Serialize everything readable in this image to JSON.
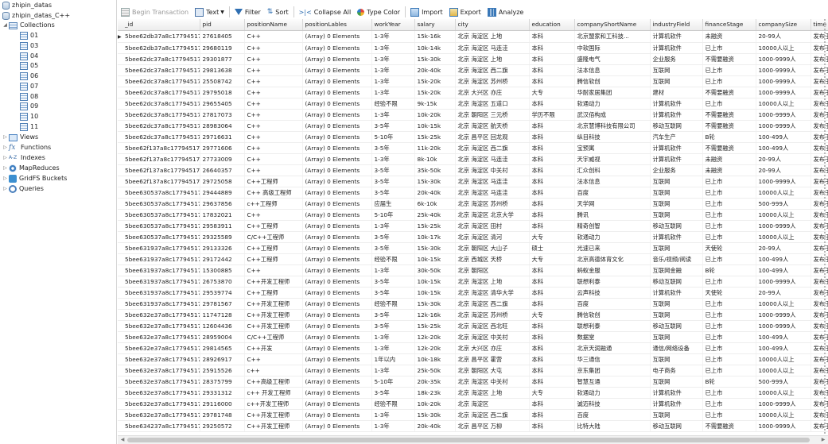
{
  "sidebar": {
    "db1": "zhipin_datas",
    "db2": "zhipin_datas_C++",
    "collections_label": "Collections",
    "collections": [
      "01",
      "03",
      "04",
      "05",
      "06",
      "07",
      "08",
      "09",
      "10",
      "11"
    ],
    "views_label": "Views",
    "functions_label": "Functions",
    "indexes_label": "Indexes",
    "mapreduces_label": "MapReduces",
    "gridfs_label": "GridFS Buckets",
    "queries_label": "Queries"
  },
  "toolbar": {
    "begin_transaction": "Begin Transaction",
    "text": "Text",
    "filter": "Filter",
    "sort": "Sort",
    "collapse_all": "Collapse All",
    "type_color": "Type Color",
    "import": "Import",
    "export": "Export",
    "analyze": "Analyze"
  },
  "grid": {
    "columns": [
      "_id",
      "pid",
      "positionName",
      "positionLables",
      "workYear",
      "salary",
      "city",
      "education",
      "companyShortName",
      "industryField",
      "financeStage",
      "companySize",
      "time"
    ],
    "rows": [
      [
        "5bee62db37a8c17794517",
        "27618405",
        "C++",
        "(Array) 0 Elements",
        "1-3年",
        "15k-16k",
        "北京 海淀区 上地",
        "本科",
        "北京盟家和工科技...",
        "计算机软件",
        "未融资",
        "20-99人",
        "发布于"
      ],
      [
        "5bee62db37a8c17794517",
        "29680119",
        "C++",
        "(Array) 0 Elements",
        "1-3年",
        "10k-14k",
        "北京 海淀区 马连洼",
        "本科",
        "中软国际",
        "计算机软件",
        "已上市",
        "10000人以上",
        "发布于"
      ],
      [
        "5bee62dc37a8c17794517",
        "29301877",
        "C++",
        "(Array) 0 Elements",
        "1-3年",
        "15k-30k",
        "北京 海淀区 上地",
        "本科",
        "盛隆电气",
        "企业服务",
        "不需要融资",
        "1000-9999人",
        "发布于"
      ],
      [
        "5bee62dc37a8c17794517",
        "29813638",
        "C++",
        "(Array) 0 Elements",
        "1-3年",
        "20k-40k",
        "北京 海淀区 西二旗",
        "本科",
        "法本信息",
        "互联网",
        "已上市",
        "1000-9999人",
        "发布于"
      ],
      [
        "5bee62dc37a8c17794517",
        "25508742",
        "C++",
        "(Array) 0 Elements",
        "1-3年",
        "15k-20k",
        "北京 海淀区 苏州桥",
        "本科",
        "腾信软创",
        "互联网",
        "已上市",
        "1000-9999人",
        "发布于"
      ],
      [
        "5bee62dc37a8c17794517",
        "29795018",
        "C++",
        "(Array) 0 Elements",
        "1-3年",
        "15k-20k",
        "北京 大兴区 亦庄",
        "大专",
        "华耐家居集团",
        "建材",
        "不需要融资",
        "1000-9999人",
        "发布于"
      ],
      [
        "5bee62dc37a8c17794517",
        "29655405",
        "C++",
        "(Array) 0 Elements",
        "经验不限",
        "9k-15k",
        "北京 海淀区 五道口",
        "本科",
        "软通动力",
        "计算机软件",
        "已上市",
        "10000人以上",
        "发布于"
      ],
      [
        "5bee62dc37a8c17794517",
        "27817073",
        "C++",
        "(Array) 0 Elements",
        "1-3年",
        "10k-20k",
        "北京 朝阳区 三元桥",
        "学历不限",
        "武汉佰构成",
        "计算机软件",
        "不需要融资",
        "1000-9999人",
        "发布于"
      ],
      [
        "5bee62dc37a8c17794517",
        "28983064",
        "C++",
        "(Array) 0 Elements",
        "3-5年",
        "10k-15k",
        "北京 海淀区 航天桥",
        "本科",
        "北京慧博科技有限公司",
        "移动互联网",
        "不需要融资",
        "1000-9999人",
        "发布于"
      ],
      [
        "5bee62dc37a8c17794517",
        "29716631",
        "C++",
        "(Array) 0 Elements",
        "5-10年",
        "15k-25k",
        "北京 昌平区 回龙观",
        "本科",
        "纵目科技",
        "汽车生产",
        "B轮",
        "100-499人",
        "发布于"
      ],
      [
        "5bee62f137a8c17794517",
        "29771606",
        "C++",
        "(Array) 0 Elements",
        "3-5年",
        "11k-20k",
        "北京 海淀区 西二旗",
        "本科",
        "宝预寓",
        "计算机软件",
        "不需要融资",
        "100-499人",
        "发布于"
      ],
      [
        "5bee62f137a8c17794517",
        "27733009",
        "C++",
        "(Array) 0 Elements",
        "1-3年",
        "8k-10k",
        "北京 海淀区 马连洼",
        "本科",
        "天宇威视",
        "计算机软件",
        "未融资",
        "20-99人",
        "发布于"
      ],
      [
        "5bee62f137a8c17794517",
        "26640357",
        "C++",
        "(Array) 0 Elements",
        "3-5年",
        "35k-50k",
        "北京 海淀区 中关村",
        "本科",
        "汇众创科",
        "企业服务",
        "未融资",
        "20-99人",
        "发布于"
      ],
      [
        "5bee62f137a8c17794517",
        "29725058",
        "C++工程师",
        "(Array) 0 Elements",
        "3-5年",
        "15k-30k",
        "北京 海淀区 马连洼",
        "本科",
        "法本信息",
        "互联网",
        "已上市",
        "1000-9999人",
        "发布于"
      ],
      [
        "5bee630537a8c17794517",
        "29444889",
        "C++ 高级工程师",
        "(Array) 0 Elements",
        "3-5年",
        "20k-40k",
        "北京 海淀区 马连洼",
        "本科",
        "百度",
        "互联网",
        "已上市",
        "10000人以上",
        "发布于"
      ],
      [
        "5bee630537a8c17794517",
        "29637856",
        "c++工程师",
        "(Array) 0 Elements",
        "应届生",
        "6k-10k",
        "北京 海淀区 苏州桥",
        "本科",
        "天学网",
        "互联网",
        "已上市",
        "500-999人",
        "发布于"
      ],
      [
        "5bee630537a8c17794517",
        "17832021",
        "C++",
        "(Array) 0 Elements",
        "5-10年",
        "25k-40k",
        "北京 海淀区 北京大学",
        "本科",
        "腾讯",
        "互联网",
        "已上市",
        "10000人以上",
        "发布于"
      ],
      [
        "5bee630537a8c17794517",
        "29583911",
        "C++工程师",
        "(Array) 0 Elements",
        "1-3年",
        "15k-25k",
        "北京 海淀区 田村",
        "本科",
        "精奇创智",
        "移动互联网",
        "已上市",
        "1000-9999人",
        "发布于"
      ],
      [
        "5bee630537a8c17794517",
        "29325589",
        "C/C++工程师",
        "(Array) 0 Elements",
        "3-5年",
        "10k-17k",
        "北京 海淀区 清河",
        "大专",
        "软通动力",
        "计算机软件",
        "已上市",
        "10000人以上",
        "发布于"
      ],
      [
        "5bee631937a8c17794517",
        "29133326",
        "C++工程师",
        "(Array) 0 Elements",
        "3-5年",
        "15k-30k",
        "北京 朝阳区 大山子",
        "硕士",
        "光速已来",
        "互联网",
        "天使轮",
        "20-99人",
        "发布于"
      ],
      [
        "5bee631937a8c17794517",
        "29172442",
        "C++工程师",
        "(Array) 0 Elements",
        "经验不限",
        "10k-15k",
        "北京 西城区 天桥",
        "大专",
        "北京高德体育文化",
        "音乐/视频/阅读",
        "已上市",
        "100-499人",
        "发布于"
      ],
      [
        "5bee631937a8c17794517",
        "15300885",
        "C++",
        "(Array) 0 Elements",
        "1-3年",
        "30k-50k",
        "北京 朝阳区",
        "本科",
        "蚂蚁金服",
        "互联网金融",
        "B轮",
        "100-499人",
        "发布于"
      ],
      [
        "5bee631937a8c17794517",
        "26753870",
        "C++开发工程师",
        "(Array) 0 Elements",
        "3-5年",
        "10k-15k",
        "北京 海淀区 上地",
        "本科",
        "联想利泰",
        "移动互联网",
        "已上市",
        "1000-9999人",
        "发布于"
      ],
      [
        "5bee631937a8c17794517",
        "29539774",
        "C++工程师",
        "(Array) 0 Elements",
        "3-5年",
        "10k-15k",
        "北京 海淀区 清华大学",
        "本科",
        "云声科技",
        "计算机软件",
        "天使轮",
        "20-99人",
        "发布于"
      ],
      [
        "5bee631937a8c17794517",
        "29781567",
        "C++开发工程师",
        "(Array) 0 Elements",
        "经验不限",
        "15k-30k",
        "北京 海淀区 西二旗",
        "本科",
        "百度",
        "互联网",
        "已上市",
        "10000人以上",
        "发布于"
      ],
      [
        "5bee632e37a8c17794517",
        "11747128",
        "C++开发工程师",
        "(Array) 0 Elements",
        "3-5年",
        "12k-16k",
        "北京 海淀区 苏州桥",
        "大专",
        "腾信软创",
        "互联网",
        "已上市",
        "1000-9999人",
        "发布于"
      ],
      [
        "5bee632e37a8c17794517",
        "12604436",
        "C++开发工程师",
        "(Array) 0 Elements",
        "3-5年",
        "15k-25k",
        "北京 海淀区 西北旺",
        "本科",
        "联想利泰",
        "移动互联网",
        "已上市",
        "1000-9999人",
        "发布于"
      ],
      [
        "5bee632e37a8c17794517",
        "28959004",
        "C/C++工程师",
        "(Array) 0 Elements",
        "1-3年",
        "12k-20k",
        "北京 海淀区 中关村",
        "本科",
        "数据堂",
        "互联网",
        "已上市",
        "100-499人",
        "发布于"
      ],
      [
        "5bee632e37a8c17794517",
        "29814565",
        "C++开发",
        "(Array) 0 Elements",
        "1-3年",
        "12k-20k",
        "北京 大兴区 亦庄",
        "本科",
        "北京天润融通",
        "通信/网络设备",
        "已上市",
        "100-499人",
        "发布于"
      ],
      [
        "5bee632e37a8c17794517",
        "28926917",
        "C++",
        "(Array) 0 Elements",
        "1年以内",
        "10k-18k",
        "北京 昌平区 霍营",
        "本科",
        "华三通信",
        "互联网",
        "已上市",
        "10000人以上",
        "发布于"
      ],
      [
        "5bee632e37a8c17794517",
        "25915526",
        "c++",
        "(Array) 0 Elements",
        "1-3年",
        "25k-50k",
        "北京 朝阳区 大屯",
        "本科",
        "京东集团",
        "电子商务",
        "已上市",
        "10000人以上",
        "发布于"
      ],
      [
        "5bee632e37a8c17794517",
        "28375799",
        "C++高级工程师",
        "(Array) 0 Elements",
        "5-10年",
        "20k-35k",
        "北京 海淀区 中关村",
        "本科",
        "智慧互通",
        "互联网",
        "B轮",
        "500-999人",
        "发布于"
      ],
      [
        "5bee632e37a8c17794517",
        "29331312",
        "c++ 开发工程师",
        "(Array) 0 Elements",
        "3-5年",
        "18k-23k",
        "北京 海淀区 上地",
        "大专",
        "软通动力",
        "计算机软件",
        "已上市",
        "10000人以上",
        "发布于"
      ],
      [
        "5bee632e37a8c17794517",
        "29116000",
        "c++开发工程师",
        "(Array) 0 Elements",
        "经验不限",
        "10k-20k",
        "北京 海淀区",
        "本科",
        "诚迈科技",
        "计算机软件",
        "已上市",
        "1000-9999人",
        "发布于"
      ],
      [
        "5bee632e37a8c17794517",
        "29781748",
        "C++开发工程师",
        "(Array) 0 Elements",
        "1-3年",
        "15k-30k",
        "北京 海淀区 西二旗",
        "本科",
        "百度",
        "互联网",
        "已上市",
        "10000人以上",
        "发布于"
      ],
      [
        "5bee634237a8c17794517",
        "29250572",
        "C++开发工程师",
        "(Array) 0 Elements",
        "1-3年",
        "20k-40k",
        "北京 昌平区 万柳",
        "本科",
        "比特大陆",
        "移动互联网",
        "不需要融资",
        "1000-9999人",
        "发布于"
      ]
    ]
  }
}
